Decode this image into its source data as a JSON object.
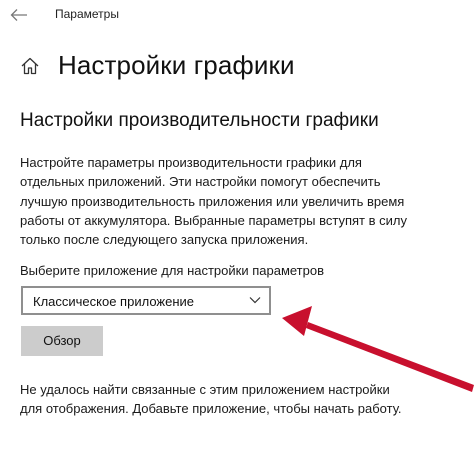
{
  "titlebar": {
    "title": "Параметры",
    "back_icon": "back-arrow-icon"
  },
  "header": {
    "home_icon": "home-icon",
    "title": "Настройки графики"
  },
  "section": {
    "title": "Настройки производительности графики",
    "description_lines": [
      "Настройте параметры производительности графики для",
      "отдельных приложений. Эти настройки помогут обеспечить",
      "лучшую производительность приложения или увеличить время",
      "работы от аккумулятора. Выбранные параметры вступят в силу",
      "только после следующего запуска приложения."
    ]
  },
  "app_picker": {
    "label": "Выберите приложение для настройки параметров",
    "selected": "Классическое приложение",
    "browse_label": "Обзор"
  },
  "notice_lines": [
    "Не удалось найти связанные с этим приложением настройки",
    "для отображения. Добавьте приложение, чтобы начать работу."
  ],
  "colors": {
    "arrow": "#c8102e",
    "button_bg": "#cccccc",
    "select_border": "#8f8f8f"
  }
}
